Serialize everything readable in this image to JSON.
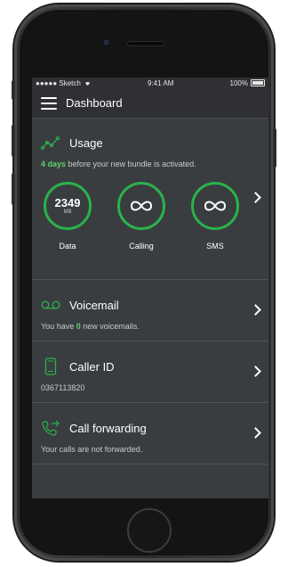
{
  "status_bar": {
    "carrier": "●●●●● Sketch",
    "time": "9:41 AM",
    "battery": "100%"
  },
  "header": {
    "title": "Dashboard"
  },
  "usage": {
    "title": "Usage",
    "note_strong": "4 days",
    "note_rest": " before your new bundle is activated.",
    "gauges": [
      {
        "value": "2349",
        "unit": "MB",
        "label": "Data"
      },
      {
        "label": "Calling",
        "icon": "infinity-icon"
      },
      {
        "label": "SMS",
        "icon": "infinity-icon"
      }
    ]
  },
  "voicemail": {
    "title": "Voicemail",
    "sub_before": "You have ",
    "sub_count": "0",
    "sub_after": " new voicemails."
  },
  "caller_id": {
    "title": "Caller ID",
    "sub": "0367113820"
  },
  "call_forwarding": {
    "title": "Call forwarding",
    "sub": "Your calls are not forwarded."
  },
  "colors": {
    "accent": "#28b34b",
    "background": "#3a3d40",
    "highlight_text": "#5fd06b"
  }
}
